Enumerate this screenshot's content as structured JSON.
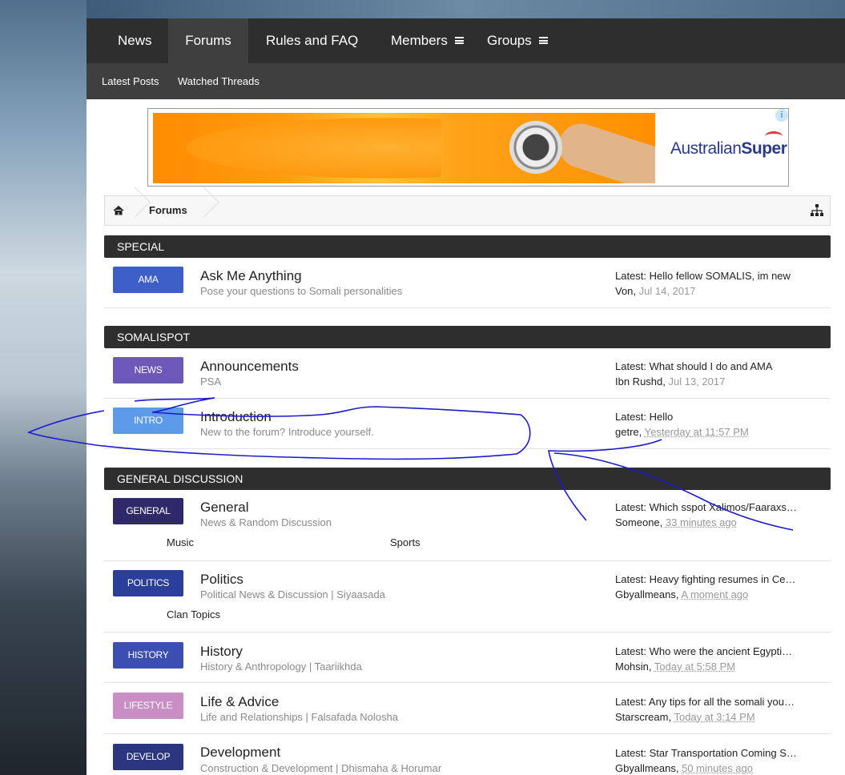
{
  "nav": {
    "tabs": [
      {
        "label": "News"
      },
      {
        "label": "Forums"
      },
      {
        "label": "Rules and FAQ"
      },
      {
        "label": "Members"
      },
      {
        "label": "Groups"
      }
    ],
    "sub_links": [
      "Latest Posts",
      "Watched Threads"
    ]
  },
  "ad": {
    "brand_regular": "Australian",
    "brand_bold": "Super",
    "info": "i"
  },
  "breadcrumb": {
    "current": "Forums"
  },
  "categories": [
    {
      "name": "SPECIAL"
    },
    {
      "name": "SOMALISPOT"
    },
    {
      "name": "GENERAL DISCUSSION"
    }
  ],
  "forums": [
    {
      "badge": "AMA",
      "title": "Ask Me Anything",
      "desc": "Pose your questions to Somali personalities",
      "latest": "Latest: Hello fellow SOMALIS, im new",
      "user": "Von",
      "date": "Jul 14, 2017"
    },
    {
      "badge": "NEWS",
      "title": "Announcements",
      "desc": "PSA",
      "latest": "Latest: What should I do and AMA",
      "user": "Ibn Rushd",
      "date": "Jul 13, 2017"
    },
    {
      "badge": "INTRO",
      "title": "Introduction",
      "desc": "New to the forum? Introduce yourself.",
      "latest": "Latest: Hello",
      "user": "getre",
      "date": "Yesterday at 11:57 PM"
    },
    {
      "badge": "GENERAL",
      "title": "General",
      "desc": "News & Random Discussion",
      "latest": "Latest: Which sspot Xalimos/Faaraxs…",
      "user": "Someone",
      "date": "33 minutes ago",
      "subforums": [
        "Music",
        "Sports"
      ]
    },
    {
      "badge": "POLITICS",
      "title": "Politics",
      "desc": "Political News & Discussion | Siyaasada",
      "latest": "Latest: Heavy fighting resumes in Ce…",
      "user": "Gbyallmeans",
      "date": "A moment ago",
      "subforums": [
        "Clan Topics"
      ]
    },
    {
      "badge": "HISTORY",
      "title": "History",
      "desc": "History & Anthropology | Taariikhda",
      "latest": "Latest: Who were the ancient Egypti…",
      "user": "Mohsin",
      "date": "Today at 5:58 PM"
    },
    {
      "badge": "LIFESTYLE",
      "title": "Life & Advice",
      "desc": "Life and Relationships | Falsafada Nolosha",
      "latest": "Latest: Any tips for all the somali you…",
      "user": "Starscream",
      "date": "Today at 3:14 PM"
    },
    {
      "badge": "DEVELOP",
      "title": "Development",
      "desc": "Construction & Development | Dhismaha & Horumar",
      "latest": "Latest: Star Transportation Coming S…",
      "user": "Gbyallmeans",
      "date": "50 minutes ago"
    }
  ],
  "colors": {
    "nav_bg": "#2e2e2e",
    "badge_ama": "#3f5fc8",
    "badge_news": "#6c58b8",
    "badge_intro": "#5b9bea",
    "badge_general": "#2e2a6a",
    "badge_politics": "#2a3f9a",
    "badge_history": "#3a4fb0",
    "badge_lifestyle": "#c98fc4",
    "badge_develop": "#2b3580",
    "annotation_ink": "#1a1ad0"
  }
}
